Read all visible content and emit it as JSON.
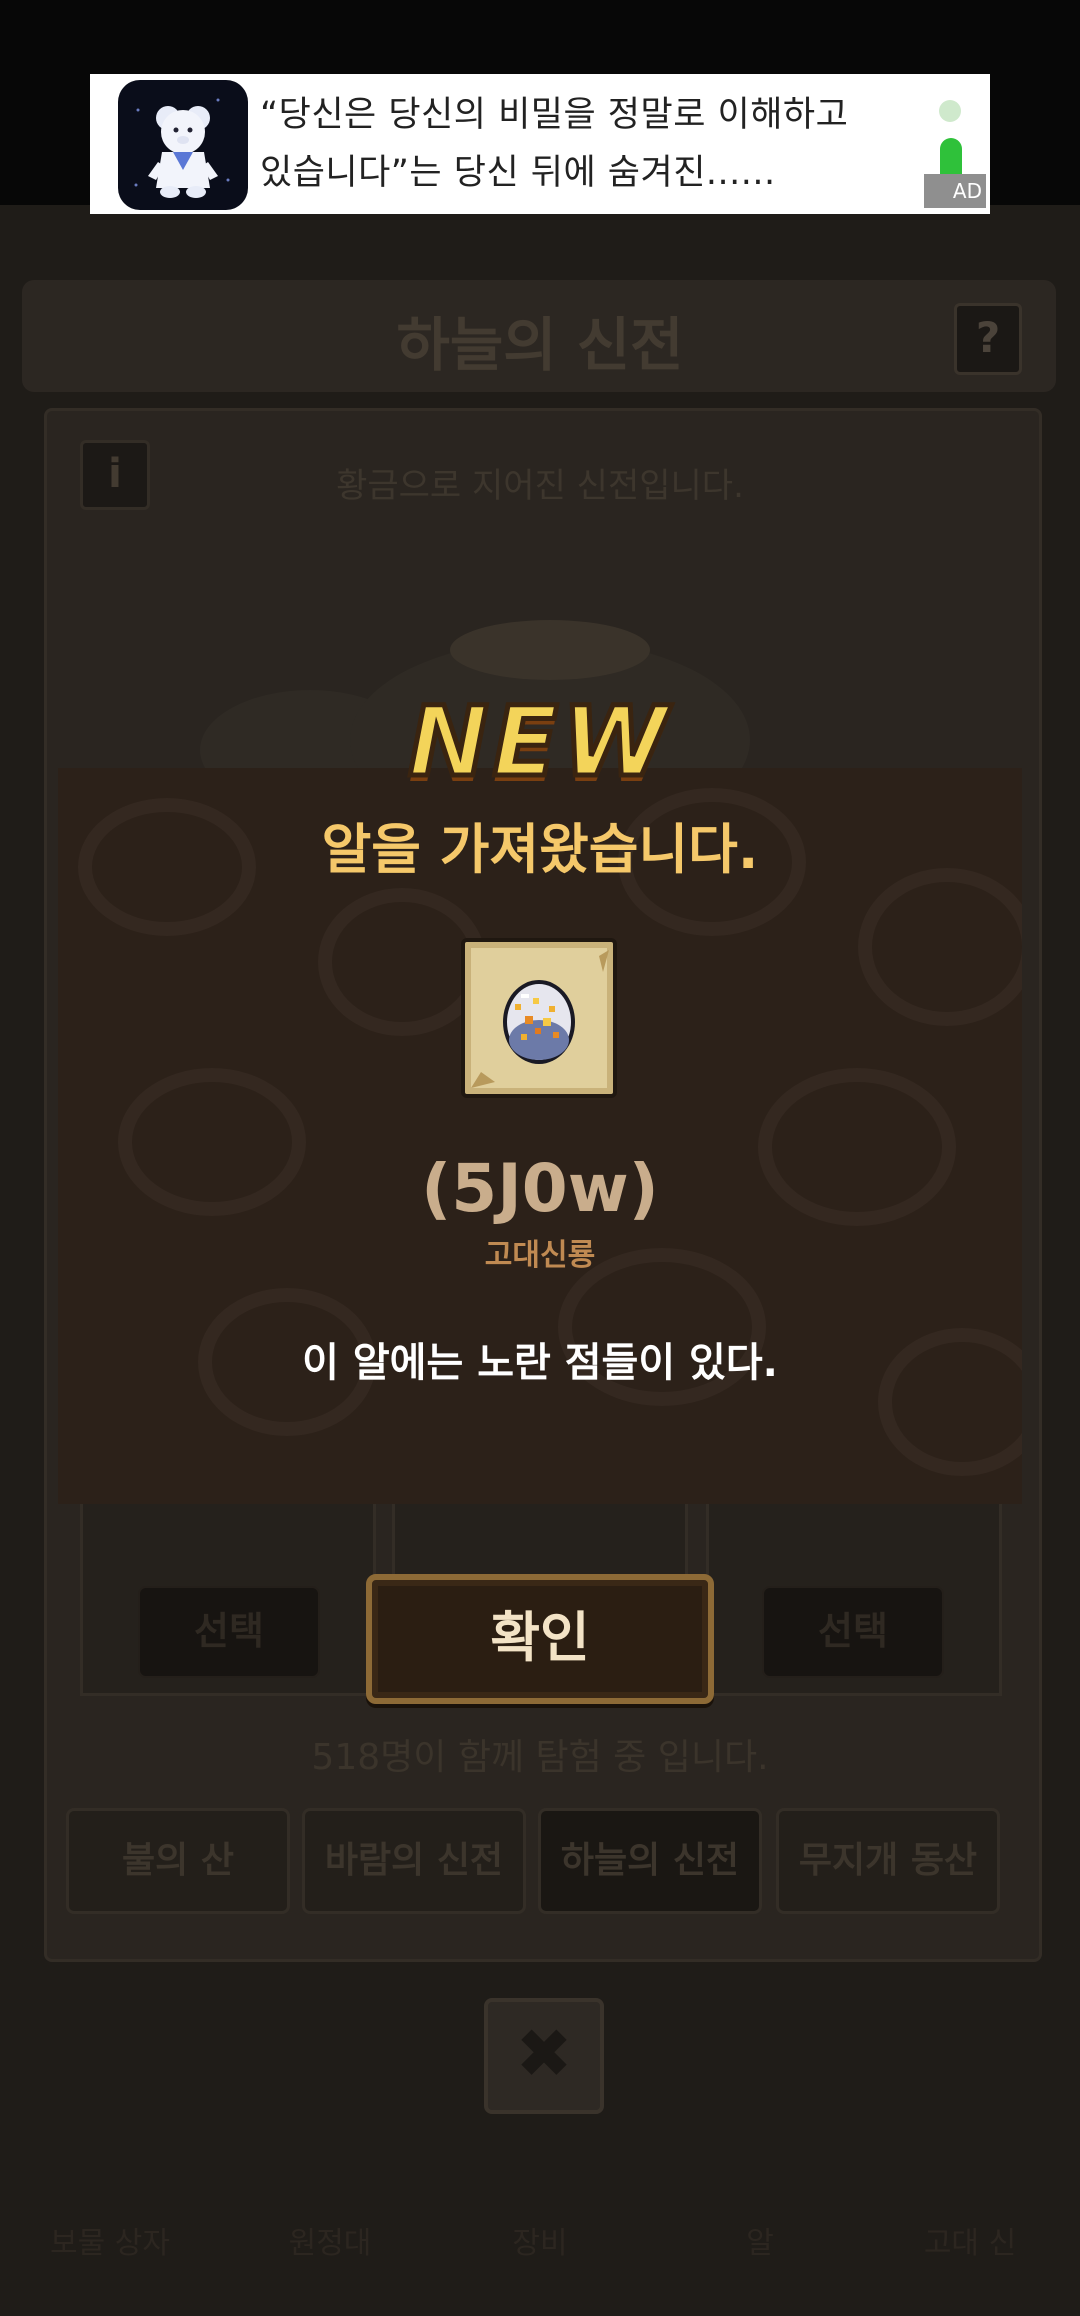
{
  "ad": {
    "text_line1": "“당신은 당신의 비밀을 정말로 이해하고",
    "text_line2": "있습니다”는 당신 뒤에 숨겨진......",
    "badge": "AD"
  },
  "background": {
    "title": "하늘의 신전",
    "help": "?",
    "info": "i",
    "subtitle": "황금으로 지어진 신전입니다.",
    "select_left": "선택",
    "select_right": "선택",
    "participants": "518명이 함께 탐험 중 입니다.",
    "tabs": [
      "불의 산",
      "바람의 신전",
      "하늘의 신전",
      "무지개 동산"
    ],
    "close": "✖",
    "bottom_labels": [
      "보물 상자",
      "원정대",
      "장비",
      "알",
      "고대 신"
    ]
  },
  "dialog": {
    "new_label": "NEW",
    "title": "알을 가져왔습니다.",
    "egg_name": "(5J0w)",
    "egg_type": "고대신룡",
    "description": "이 알에는 노란 점들이 있다.",
    "confirm_label": "확인"
  },
  "colors": {
    "accent_gold": "#f5c86a",
    "dialog_bg": "#2c2119",
    "ad_green": "#2fc13a"
  }
}
